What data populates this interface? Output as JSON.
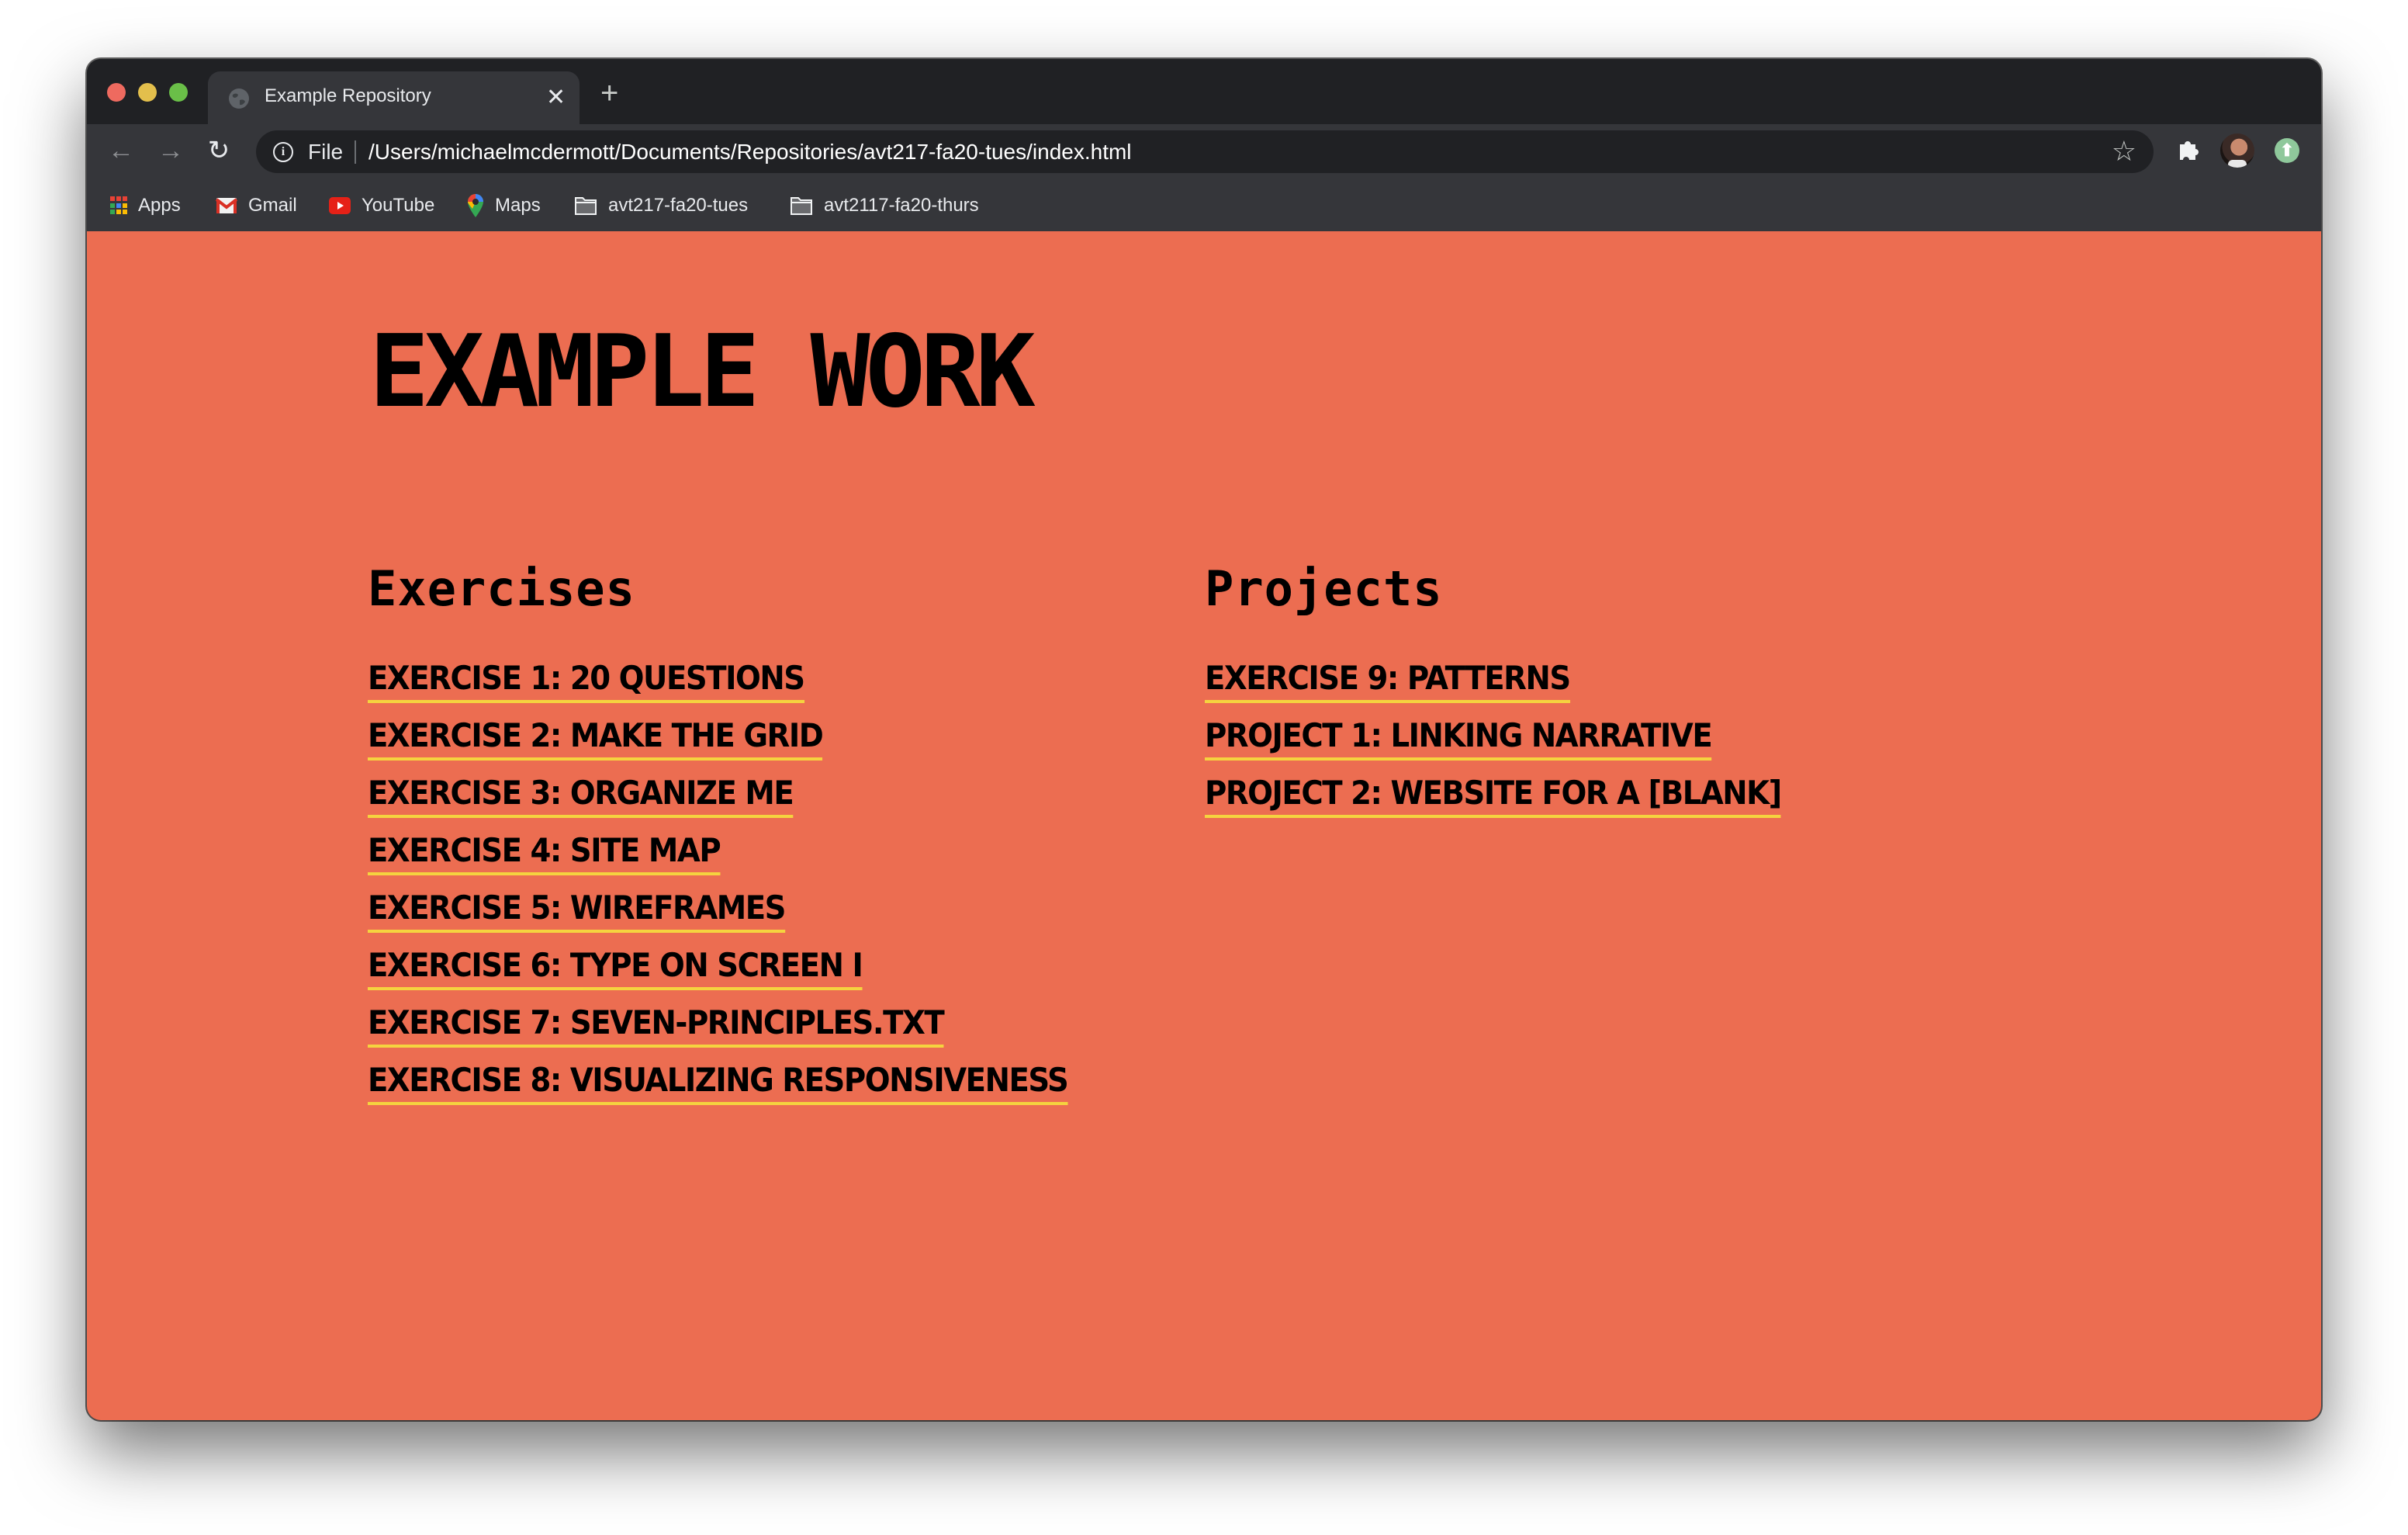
{
  "browser": {
    "tab": {
      "title": "Example Repository",
      "favicon": "globe-icon",
      "close_glyph": "✕"
    },
    "new_tab_glyph": "+",
    "nav": {
      "back_glyph": "←",
      "forward_glyph": "→",
      "reload_glyph": "↻"
    },
    "omnibox": {
      "info_glyph": "i",
      "scheme_label": "File",
      "url": "/Users/michaelmcdermott/Documents/Repositories/avt217-fa20-tues/index.html",
      "star_glyph": "☆"
    },
    "toolbar_icons": [
      "puzzle-icon",
      "avatar",
      "update-icon"
    ],
    "update_glyph": "⬆",
    "bookmarks": [
      {
        "label": "Apps",
        "icon": "apps-grid-icon"
      },
      {
        "label": "Gmail",
        "icon": "gmail-icon"
      },
      {
        "label": "YouTube",
        "icon": "youtube-icon"
      },
      {
        "label": "Maps",
        "icon": "maps-icon"
      },
      {
        "label": "avt217-fa20-tues",
        "icon": "folder-icon"
      },
      {
        "label": "avt2117-fa20-thurs",
        "icon": "folder-icon"
      }
    ]
  },
  "page": {
    "title": "EXAMPLE WORK",
    "colors": {
      "background": "#EC6D51",
      "text": "#000000",
      "link_underline": "#F5D33F"
    },
    "sections": [
      {
        "heading": "Exercises",
        "links": [
          "EXERCISE 1: 20 QUESTIONS",
          "EXERCISE 2: MAKE THE GRID",
          "EXERCISE 3: ORGANIZE ME",
          "EXERCISE 4: SITE MAP",
          "EXERCISE 5: WIREFRAMES",
          "EXERCISE 6: TYPE ON SCREEN I",
          "EXERCISE 7: SEVEN-PRINCIPLES.TXT",
          "EXERCISE 8: VISUALIZING RESPONSIVENESS"
        ]
      },
      {
        "heading": "Projects",
        "links": [
          "EXERCISE 9: PATTERNS",
          "PROJECT 1: LINKING NARRATIVE",
          "PROJECT 2: WEBSITE FOR A [BLANK]"
        ]
      }
    ]
  }
}
